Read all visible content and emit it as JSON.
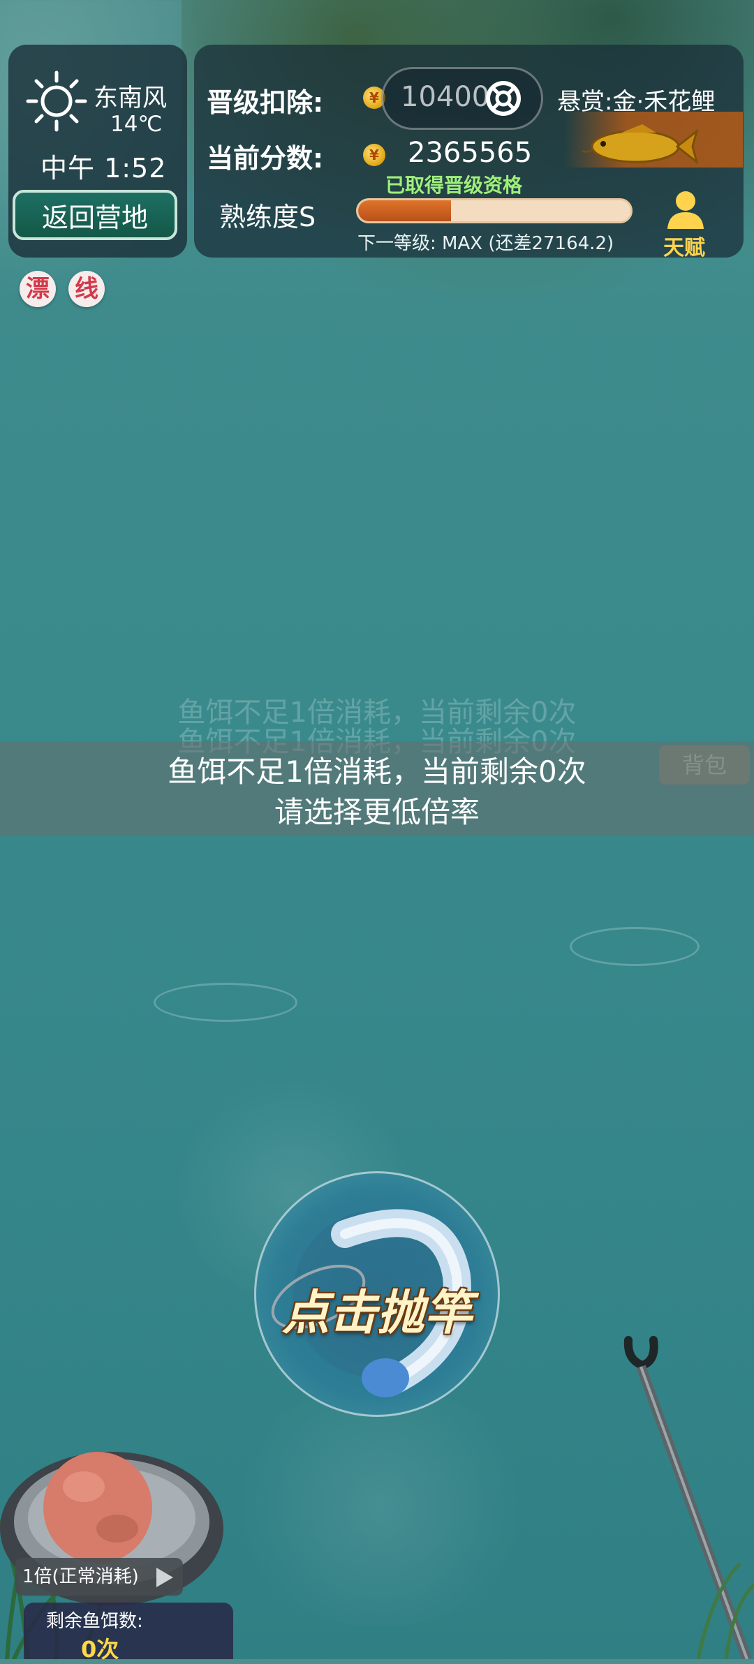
{
  "weather": {
    "wind": "东南风",
    "temperature": "14℃",
    "time": "中午 1:52",
    "icon": "sun-icon"
  },
  "back_button": "返回营地",
  "tags": [
    "漂",
    "线"
  ],
  "info": {
    "deduct_label": "晋级扣除:",
    "deduct_value": "10400",
    "score_label": "当前分数:",
    "score_value": "2365565",
    "bounty": "悬赏:金·禾花鲤",
    "qualified": "已取得晋级资格",
    "proficiency_label": "熟练度S",
    "proficiency_progress": 0.34,
    "next_level": "下一等级: MAX (还差27164.2)",
    "talent": "天赋"
  },
  "toast": {
    "line1": "鱼饵不足1倍消耗，当前剩余0次",
    "line2": "请选择更低倍率",
    "ghost_badge": "背包"
  },
  "cast_button": "点击抛竿",
  "bait": {
    "multiplier": "1倍(正常消耗)",
    "remaining_label": "剩余鱼饵数:",
    "remaining_count": "0次"
  },
  "colors": {
    "accent_gold": "#ffd34d",
    "qualified_green": "#9ff07a",
    "progress": "#e0742a"
  }
}
